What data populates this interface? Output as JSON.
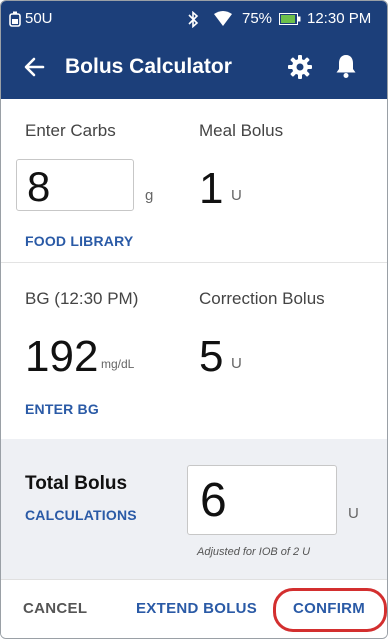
{
  "status_bar": {
    "left_text": "50U",
    "battery": "75%",
    "time": "12:30 PM",
    "icons": [
      "insulin-reservoir-icon",
      "bluetooth-icon",
      "wifi-icon",
      "battery-icon"
    ]
  },
  "header": {
    "title": "Bolus Calculator",
    "back_icon": "back-arrow-icon",
    "settings_icon": "gear-icon",
    "notifications_icon": "bell-icon"
  },
  "carbs": {
    "label": "Enter Carbs",
    "value": "8",
    "unit": "g",
    "link": "FOOD LIBRARY"
  },
  "meal_bolus": {
    "label": "Meal Bolus",
    "value": "1",
    "unit": "U"
  },
  "bg": {
    "label": "BG (12:30 PM)",
    "value": "192",
    "unit": "mg/dL",
    "link": "ENTER BG"
  },
  "correction_bolus": {
    "label": "Correction Bolus",
    "value": "5",
    "unit": "U"
  },
  "total_bolus": {
    "label": "Total Bolus",
    "link": "CALCULATIONS",
    "value": "6",
    "unit": "U",
    "note": "Adjusted for IOB of 2 U"
  },
  "actions": {
    "cancel": "CANCEL",
    "extend": "EXTEND BOLUS",
    "confirm": "CONFIRM"
  },
  "colors": {
    "header": "#1c3f7a",
    "link": "#2a5aa6",
    "highlight": "#d32f2f",
    "total_bg": "#eef0f4"
  }
}
